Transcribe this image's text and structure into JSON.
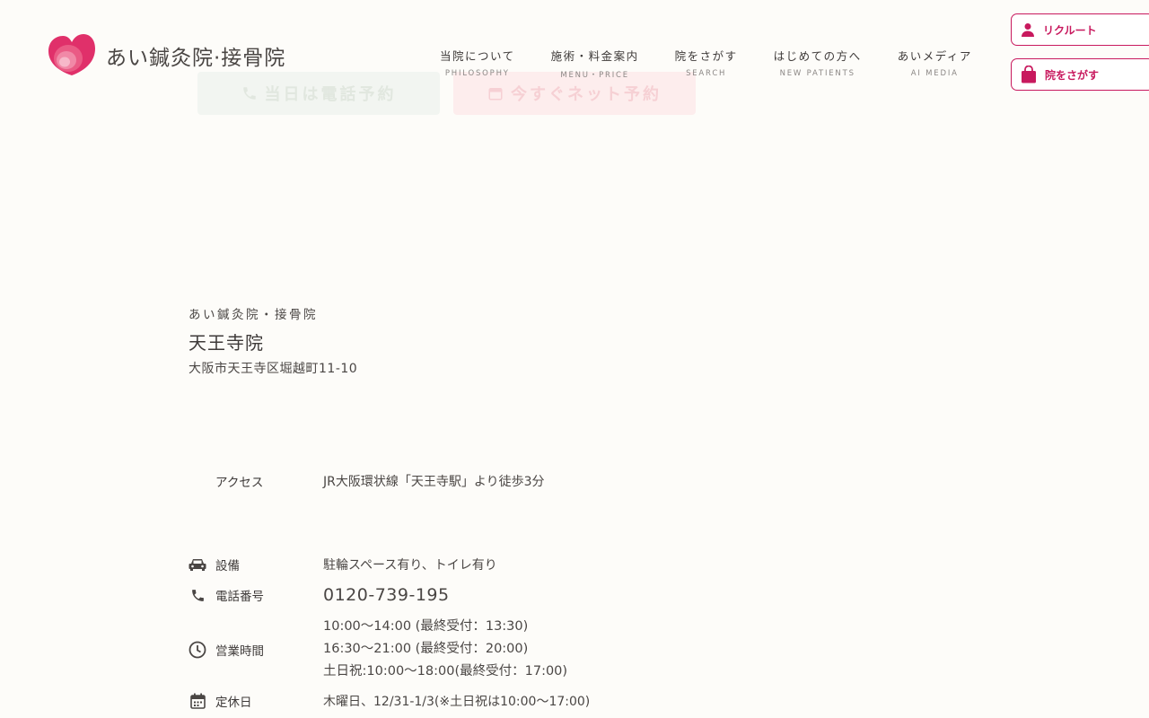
{
  "brand": {
    "logo_text": "あい鍼灸院·接骨院"
  },
  "ghost_buttons": {
    "tel_label": "当日は電話予約",
    "net_label": "今すぐネット予約"
  },
  "nav": [
    {
      "jp": "当院について",
      "en": "PHILOSOPHY"
    },
    {
      "jp": "施術・料金案内",
      "en": "MENU・PRICE"
    },
    {
      "jp": "院をさがす",
      "en": "SEARCH"
    },
    {
      "jp": "はじめての方へ",
      "en": "NEW PATIENTS"
    },
    {
      "jp": "あいメディア",
      "en": "AI MEDIA"
    }
  ],
  "side": {
    "recruit_label": "リクルート",
    "search_label": "院をさがす"
  },
  "clinic": {
    "brand": "あい鍼灸院・接骨院",
    "name": "天王寺院",
    "address": "大阪市天王寺区堀越町11-10"
  },
  "info": {
    "access": {
      "label": "アクセス",
      "value": "JR大阪環状線「天王寺駅」より徒歩3分"
    },
    "facilities": {
      "label": "設備",
      "value": "駐輪スペース有り、トイレ有り",
      "icon": "car-icon"
    },
    "tel": {
      "label": "電話番号",
      "value": "0120-739-195",
      "icon": "phone-icon"
    },
    "hours": {
      "label": "営業時間",
      "icon": "clock-icon",
      "lines": [
        "10:00〜14:00 (最終受付：13:30)",
        "16:30〜21:00 (最終受付：20:00)",
        "土日祝:10:00〜18:00(最終受付：17:00)"
      ]
    },
    "closed": {
      "label": "定休日",
      "value": "木曜日、12/31-1/3(※土日祝は10:00〜17:00)",
      "icon": "calendar-icon"
    }
  },
  "colors": {
    "accent": "#c8195e",
    "text": "#3e3a39",
    "background": "#fdfcf9"
  }
}
